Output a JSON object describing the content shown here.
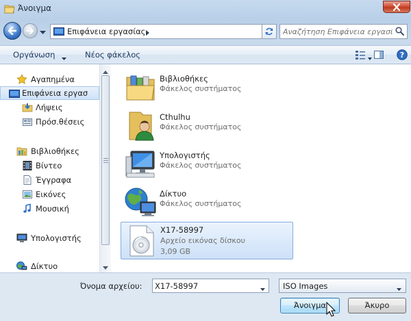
{
  "window": {
    "title": "Άνοιγμα",
    "title_icon": "folder-open-icon"
  },
  "nav": {
    "back_icon": "back-arrow-icon",
    "forward_icon": "forward-arrow-icon",
    "address_path": "Επιφάνεια εργασίας",
    "address_icon": "desktop-icon",
    "search_placeholder": "Αναζήτηση Επιφάνεια εργασί..."
  },
  "toolbar": {
    "organize_label": "Οργάνωση",
    "new_folder_label": "Νέος φάκελος"
  },
  "sidebar": {
    "items": [
      {
        "label": "Αγαπημένα",
        "icon": "star-icon"
      },
      {
        "label": "Επιφάνεια εργασ",
        "icon": "desktop-icon",
        "selected": true
      },
      {
        "label": "Λήψεις",
        "icon": "downloads-icon"
      },
      {
        "label": "Πρόσ.θέσεις",
        "icon": "recent-places-icon"
      },
      {
        "label": "Βιβλιοθήκες",
        "icon": "libraries-icon"
      },
      {
        "label": "Βίντεο",
        "icon": "video-icon"
      },
      {
        "label": "Έγγραφα",
        "icon": "documents-icon"
      },
      {
        "label": "Εικόνες",
        "icon": "pictures-icon"
      },
      {
        "label": "Μουσική",
        "icon": "music-icon"
      },
      {
        "label": "Υπολογιστής",
        "icon": "computer-icon"
      },
      {
        "label": "Δίκτυο",
        "icon": "network-icon"
      }
    ]
  },
  "files": [
    {
      "name": "Βιβλιοθήκες",
      "desc": "Φάκελος συστήματος",
      "icon": "libraries-folder-icon"
    },
    {
      "name": "Cthulhu",
      "desc": "Φάκελος συστήματος",
      "icon": "user-folder-icon"
    },
    {
      "name": "Υπολογιστής",
      "desc": "Φάκελος συστήματος",
      "icon": "computer-icon"
    },
    {
      "name": "Δίκτυο",
      "desc": "Φάκελος συστήματος",
      "icon": "network-globe-icon"
    },
    {
      "name": "X17-58997",
      "desc": "Αρχείο εικόνας δίσκου",
      "size": "3,09 GB",
      "icon": "disc-image-icon",
      "selected": true
    }
  ],
  "footer": {
    "filename_label": "Όνομα αρχείου:",
    "filename_value": "X17-58997",
    "filetype_value": "ISO Images",
    "open_label": "Άνοιγμα",
    "cancel_label": "Άκυρο"
  },
  "colors": {
    "selection": "#cde1f8",
    "selection_border": "#84acdd",
    "close_button": "#c03a1e"
  }
}
